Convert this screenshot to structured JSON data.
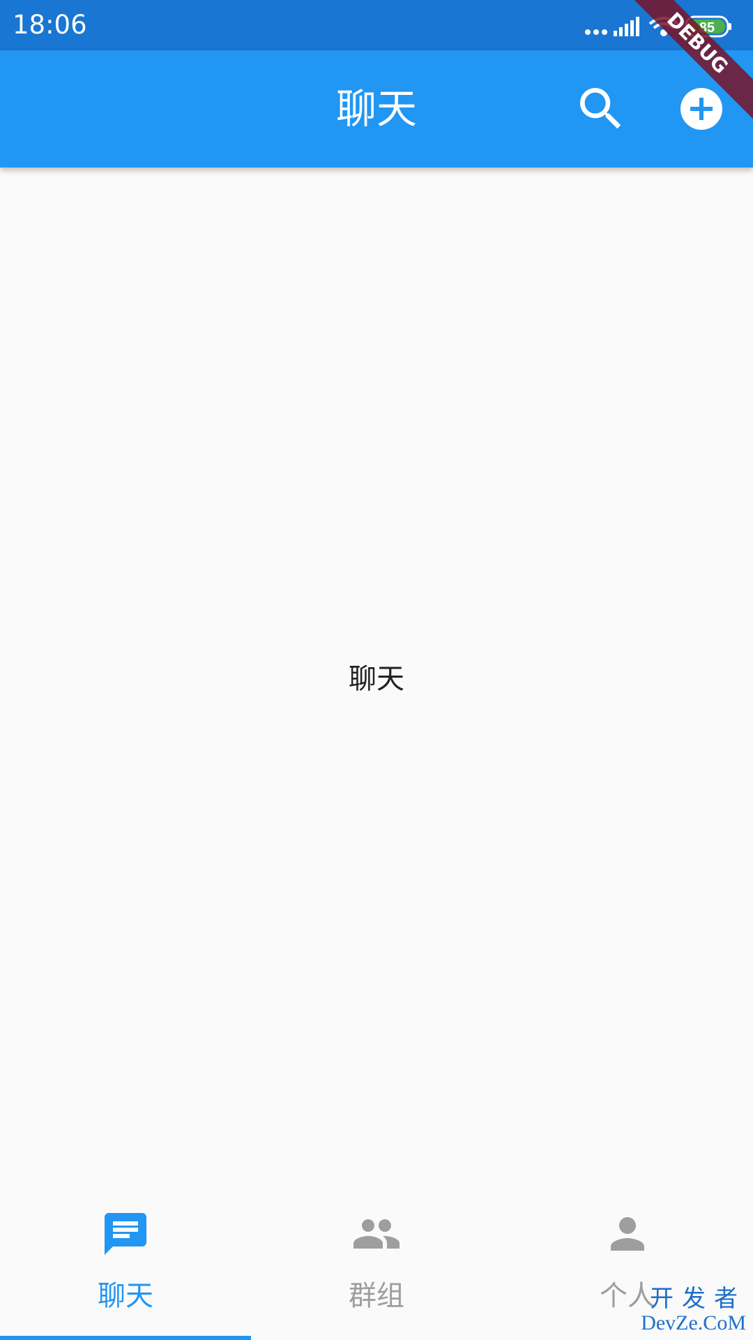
{
  "status_bar": {
    "time": "18:06",
    "battery": "85"
  },
  "app_bar": {
    "title": "聊天",
    "debug_label": "DEBUG"
  },
  "content": {
    "center_text": "聊天"
  },
  "bottom_nav": {
    "items": [
      {
        "label": "聊天",
        "icon": "chat-icon",
        "active": true
      },
      {
        "label": "群组",
        "icon": "group-icon",
        "active": false
      },
      {
        "label": "个人",
        "icon": "person-icon",
        "active": false
      }
    ]
  },
  "watermark": {
    "line1": "开发者",
    "line2": "DevZe.CoM"
  },
  "colors": {
    "status_bar": "#1976d2",
    "app_bar": "#2196f3",
    "active": "#2196f3",
    "inactive": "#9e9e9e",
    "battery": "#4caf50"
  }
}
